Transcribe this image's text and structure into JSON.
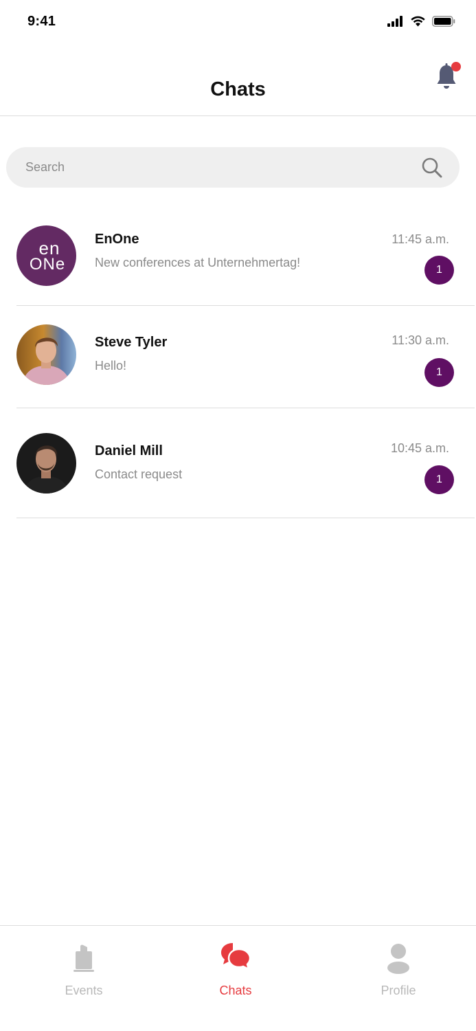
{
  "status_bar": {
    "time": "9:41"
  },
  "header": {
    "title": "Chats"
  },
  "search": {
    "placeholder": "Search"
  },
  "chats": [
    {
      "name": "EnOne",
      "preview": "New conferences at Unternehmertag!",
      "time": "11:45 a.m.",
      "unread": "1",
      "avatar_logo": [
        "en",
        "ONe"
      ]
    },
    {
      "name": "Steve Tyler",
      "preview": "Hello!",
      "time": "11:30 a.m.",
      "unread": "1"
    },
    {
      "name": "Daniel Mill",
      "preview": "Contact request",
      "time": "10:45 a.m.",
      "unread": "1"
    }
  ],
  "tabs": [
    {
      "label": "Events",
      "icon": "events-icon",
      "active": false
    },
    {
      "label": "Chats",
      "icon": "chats-icon",
      "active": true
    },
    {
      "label": "Profile",
      "icon": "profile-icon",
      "active": false
    }
  ],
  "colors": {
    "accent": "#e63b3f",
    "badge": "#5f0f63",
    "brand_avatar": "#632a63",
    "inactive": "#b8b8b8"
  }
}
